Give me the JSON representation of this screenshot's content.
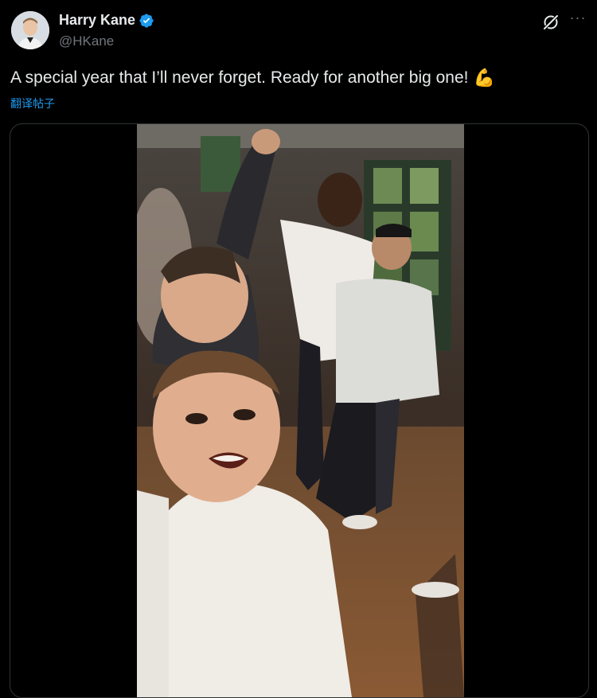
{
  "tweet": {
    "display_name": "Harry Kane",
    "handle": "@HKane",
    "text": "A special year that I’ll never forget. Ready for another big one!",
    "emoji": "💪",
    "translate_label": "翻译帖子",
    "more_label": "···"
  },
  "colors": {
    "background": "#000000",
    "primary_text": "#e7e9ea",
    "secondary_text": "#71767b",
    "link": "#1d9bf0",
    "verified_badge": "#1d9bf0",
    "border": "#2f3336"
  },
  "icons": {
    "verified": "verified-badge-icon",
    "grok": "grok-icon",
    "more": "more-icon"
  }
}
